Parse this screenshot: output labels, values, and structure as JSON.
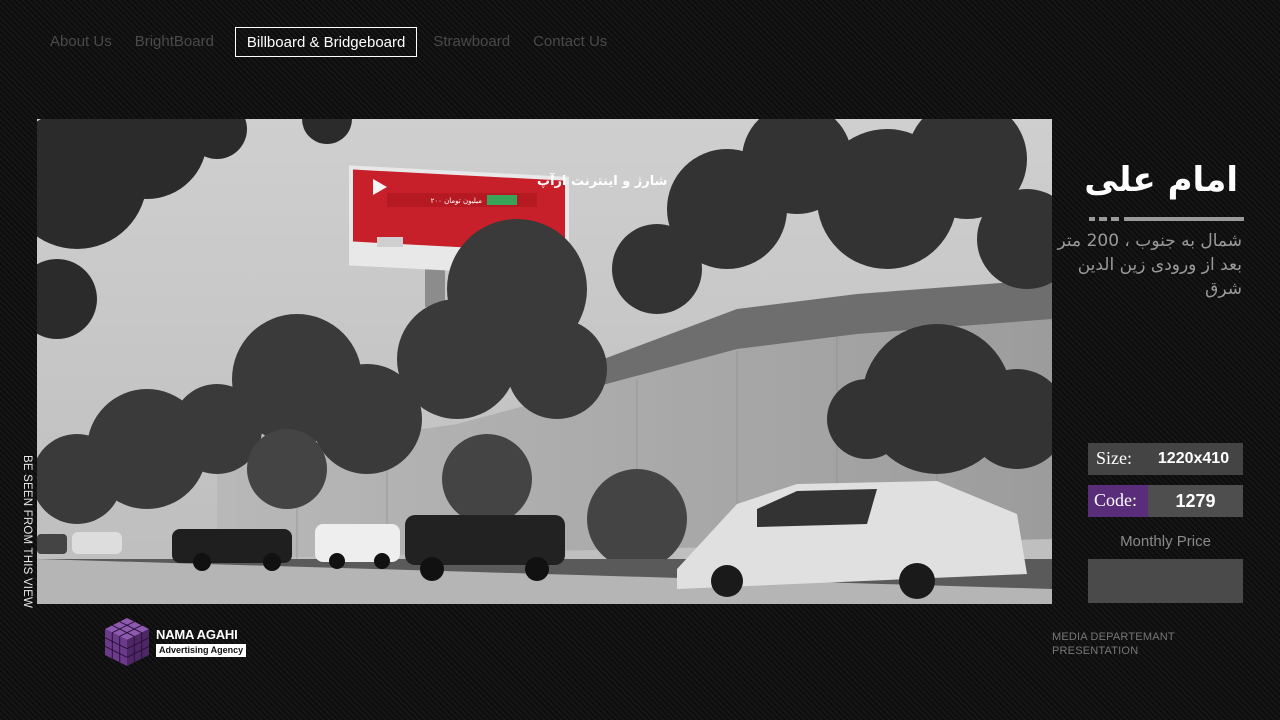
{
  "nav": {
    "items": [
      {
        "label": "About Us",
        "active": false
      },
      {
        "label": "BrightBoard",
        "active": false
      },
      {
        "label": "Billboard & Bridgeboard",
        "active": true
      },
      {
        "label": "Strawboard",
        "active": false
      },
      {
        "label": "Contact Us",
        "active": false
      }
    ]
  },
  "photo": {
    "billboard_headline": "با خرید شارژ و اینترنت ازآپ",
    "billboard_line2": "۲۰۰ میلیون تومان",
    "vertical_caption": "BE SEEN FROM THIS VIEW"
  },
  "location": {
    "title": "امام علی",
    "description": "شمال به جنوب ، 200 متر بعد از ورودی زین الدین شرق"
  },
  "specs": {
    "size_label": "Size:",
    "size_value": "1220x410",
    "code_label": "Code:",
    "code_value": "1279",
    "monthly_price_label": "Monthly Price",
    "monthly_price_value": ""
  },
  "logo": {
    "name": "NAMA AGAHI",
    "tagline": "Advertising Agency"
  },
  "footer": {
    "line1": "MEDIA DEPARTEMANT",
    "line2": "PRESENTATION"
  },
  "colors": {
    "code_accent": "#5a2d7a",
    "spec_box": "#444444",
    "billboard_red": "#c8202a",
    "logo_purple": "#6b3a8a"
  }
}
